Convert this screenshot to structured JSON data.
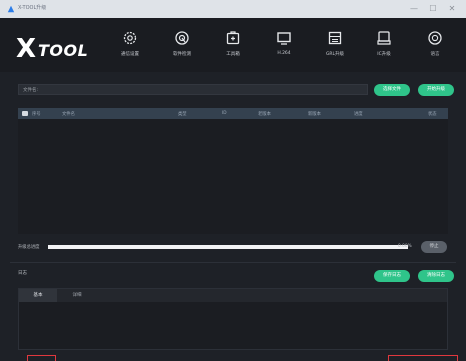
{
  "window": {
    "title": "X-TOOL升级",
    "minimize_glyph": "—",
    "maximize_glyph": "☐",
    "close_glyph": "✕"
  },
  "header": {
    "logo_mark": "X",
    "logo_text": "TOOL",
    "nav": [
      {
        "label": "通信设置",
        "icon": "gear-icon"
      },
      {
        "label": "软件检测",
        "icon": "scan-icon"
      },
      {
        "label": "工具箱",
        "icon": "toolbox-icon"
      },
      {
        "label": "H.264",
        "icon": "monitor-icon"
      },
      {
        "label": "GRL升级",
        "icon": "chip-board-icon"
      },
      {
        "label": "IC升级",
        "icon": "module-icon"
      },
      {
        "label": "语言",
        "icon": "globe-icon"
      }
    ]
  },
  "file_row": {
    "label": "文件名:",
    "select_button": "选择文件",
    "start_button": "开始升级"
  },
  "table": {
    "columns": [
      "序号",
      "文件名",
      "类型",
      "ID",
      "老版本",
      "新版本",
      "进度",
      "状态"
    ],
    "rows": []
  },
  "progress": {
    "label": "升级总进度",
    "value_percent": 0,
    "percent_text": "0.00%",
    "stop_button": "停止"
  },
  "log": {
    "label": "日志",
    "save_button": "保存日志",
    "clear_button": "清除日志",
    "tabs": [
      {
        "label": "基本",
        "active": true
      },
      {
        "label": "详细",
        "active": false
      }
    ]
  },
  "colors": {
    "accent": "#2fc48a",
    "background": "#1e2127",
    "header": "#1a1c21",
    "table_header": "#34414f",
    "highlight_box": "#e0383e"
  }
}
